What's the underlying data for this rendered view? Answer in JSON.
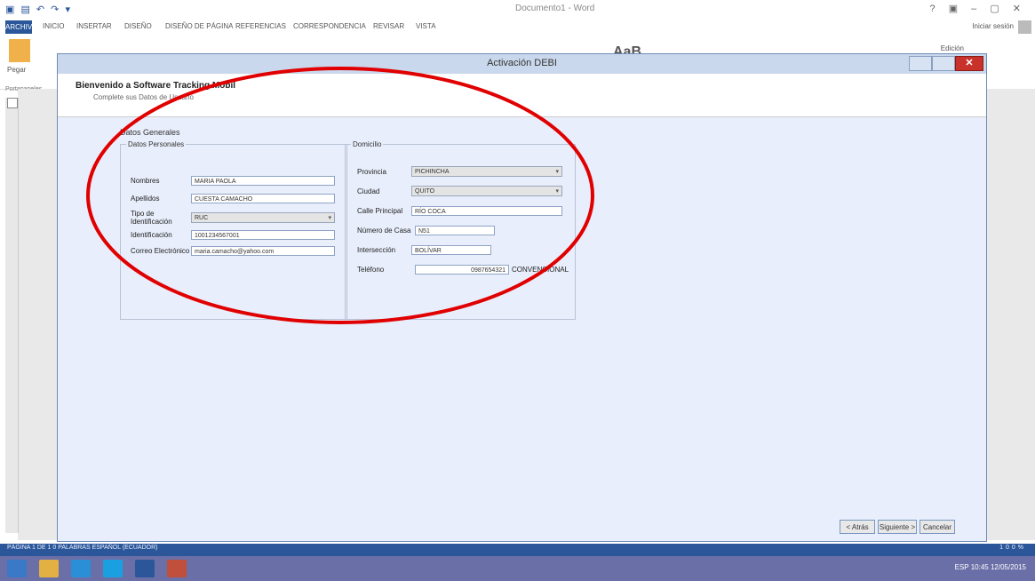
{
  "word": {
    "title": "Documento1 - Word",
    "file_tab": "ARCHIVO",
    "tabs": [
      "INICIO",
      "INSERTAR",
      "DISEÑO",
      "DISEÑO DE PÁGINA",
      "REFERENCIAS",
      "CORRESPONDENCIA",
      "REVISAR",
      "VISTA"
    ],
    "user": "Iniciar sesión",
    "paste_label": "Pegar",
    "clipboard_group": "Portapapeles",
    "editar": "Edición",
    "font_preview": "AaB"
  },
  "dialog": {
    "title": "Activación DEBI",
    "close_glyph": "✕",
    "welcome": "Bienvenido a Software Tracking Mobil",
    "subtitle": "Complete sus Datos de Usuario",
    "section_title": "Datos Generales",
    "personal": {
      "legend": "Datos Personales",
      "nombres_label": "Nombres",
      "nombres_value": "MARIA PAOLA",
      "apellidos_label": "Apellidos",
      "apellidos_value": "CUESTA CAMACHO",
      "tipo_id_label": "Tipo de Identificación",
      "tipo_id_value": "RUC",
      "identificacion_label": "Identificación",
      "identificacion_value": "1001234567001",
      "correo_label": "Correo Electrónico",
      "correo_value": "maria.camacho@yahoo.com"
    },
    "domicilio": {
      "legend": "Domicilio",
      "provincia_label": "Provincia",
      "provincia_value": "PICHINCHA",
      "ciudad_label": "Ciudad",
      "ciudad_value": "QUITO",
      "calle_label": "Calle Principal",
      "calle_value": "RÍO COCA",
      "numero_label": "Número de Casa",
      "numero_value": "N51",
      "interseccion_label": "Intersección",
      "interseccion_value": "BOLÍVAR",
      "telefono_label": "Teléfono",
      "telefono_value": "0987654321",
      "convencional_value": "CONVENCIONAL"
    },
    "buttons": {
      "back": "< Atrás",
      "next": "Siguiente >",
      "cancel": "Cancelar"
    }
  },
  "statusbar": {
    "text": "PÁGINA 1 DE 1    0 PALABRAS    ESPAÑOL (ECUADOR)",
    "right": "100%"
  },
  "taskbar": {
    "clock": "ESP  10:45  12/05/2015"
  },
  "colors": {
    "annotation": "#e00000",
    "accent": "#2b579a",
    "dialog_body": "#e8eefb"
  }
}
